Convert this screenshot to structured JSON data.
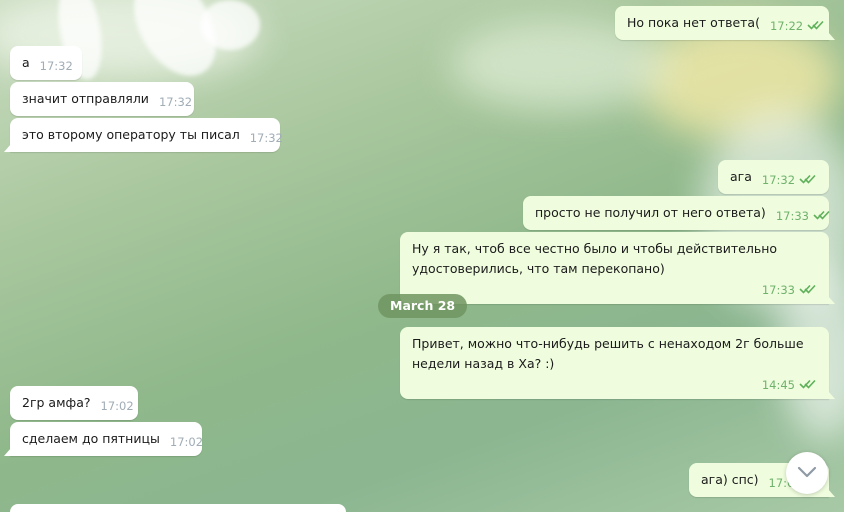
{
  "chat": {
    "date_separator": "March 28",
    "messages": [
      {
        "text": "Но пока нет ответа(",
        "time": "17:22",
        "side": "out"
      },
      {
        "text": "а",
        "time": "17:32",
        "side": "in"
      },
      {
        "text": "значит отправляли",
        "time": "17:32",
        "side": "in"
      },
      {
        "text": "это второму оператору ты писал",
        "time": "17:32",
        "side": "in"
      },
      {
        "text": "ага",
        "time": "17:32",
        "side": "out"
      },
      {
        "text": "просто не получил от него ответа)",
        "time": "17:33",
        "side": "out"
      },
      {
        "text": "Ну я так, чтоб все честно было и чтобы действительно удостоверились, что там перекопано)",
        "time": "17:33",
        "side": "out"
      },
      {
        "text": "Привет, можно что-нибудь решить с ненаходом 2г больше недели назад в Ха? :)",
        "time": "14:45",
        "side": "out"
      },
      {
        "text": "2гр амфа?",
        "time": "17:02",
        "side": "in"
      },
      {
        "text": "сделаем до пятницы",
        "time": "17:02",
        "side": "in"
      },
      {
        "text": "ага) спс)",
        "time": "17:02",
        "side": "out"
      }
    ]
  },
  "icons": {
    "read_receipt": "double-check-icon",
    "scroll_down": "chevron-down-icon"
  },
  "colors": {
    "incoming_bubble": "#ffffff",
    "outgoing_bubble": "#effdde",
    "outgoing_time": "#6fb26c",
    "incoming_time": "#a0acb6",
    "date_pill": "#709460"
  }
}
